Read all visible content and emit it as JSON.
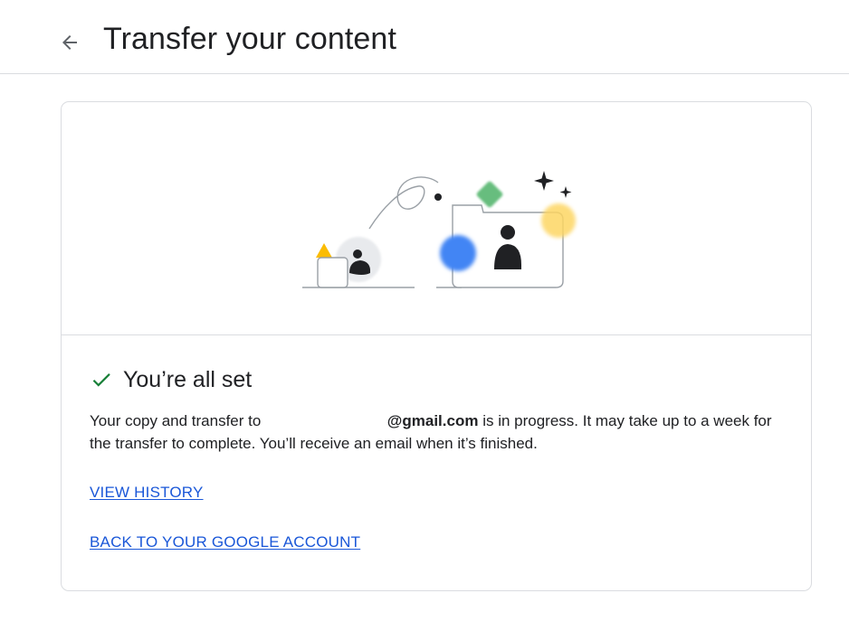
{
  "header": {
    "back_icon": "arrow-left-icon",
    "title": "Transfer your content"
  },
  "status": {
    "icon": "check-icon",
    "icon_color": "#188038",
    "title": "You’re all set"
  },
  "message": {
    "prefix": "Your copy and transfer to",
    "email_suffix": "@gmail.com",
    "suffix": "is in progress. It may take up to a week for the transfer to complete. You’ll receive an email when it’s finished."
  },
  "links": {
    "view_history": "VIEW HISTORY",
    "back_to_account": "BACK TO YOUR GOOGLE ACCOUNT",
    "color": "#1a57d8"
  }
}
